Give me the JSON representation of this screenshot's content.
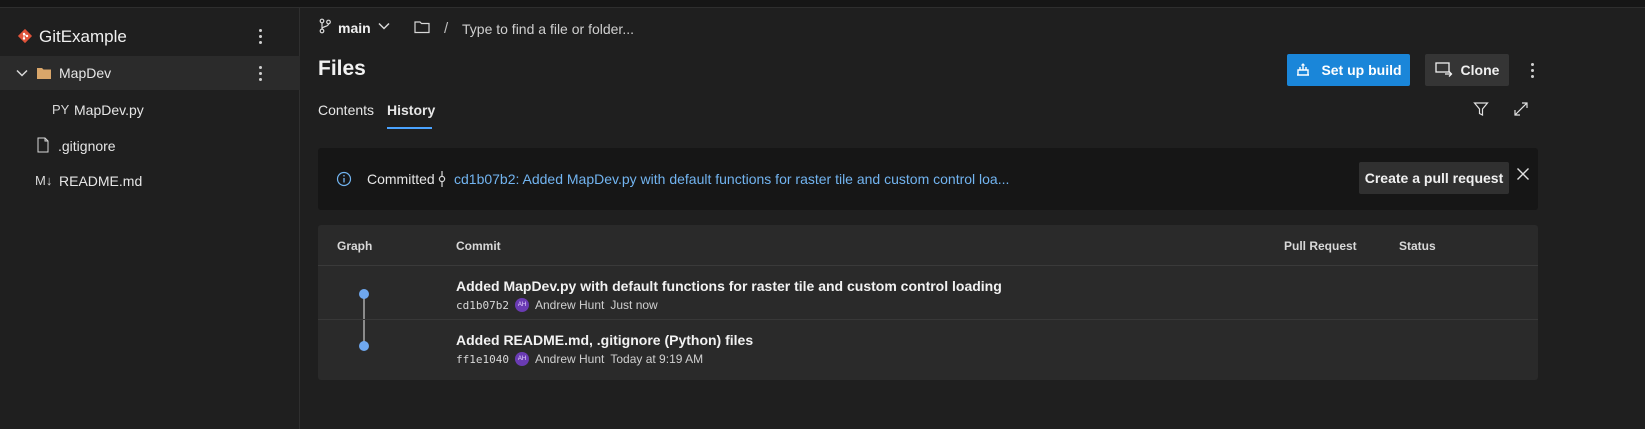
{
  "sidebar": {
    "repo_name": "GitExample",
    "items": [
      {
        "label": "MapDev",
        "type": "folder",
        "expanded": true
      },
      {
        "label": "MapDev.py",
        "type": "file",
        "prefix": "PY"
      },
      {
        "label": ".gitignore",
        "type": "file"
      },
      {
        "label": "README.md",
        "type": "file",
        "prefix": "M↓"
      }
    ]
  },
  "breadcrumb": {
    "branch": "main",
    "separator": "/",
    "path_placeholder": "Type to find a file or folder..."
  },
  "header": {
    "title": "Files",
    "setup_build_label": "Set up build",
    "clone_label": "Clone"
  },
  "tabs": [
    {
      "label": "Contents",
      "active": false
    },
    {
      "label": "History",
      "active": true
    }
  ],
  "banner": {
    "prefix": "Committed",
    "commit_text": "cd1b07b2: Added MapDev.py with default functions for raster tile and custom control loa...",
    "pull_request_label": "Create a pull request"
  },
  "history_table": {
    "columns": [
      "Graph",
      "Commit",
      "Pull Request",
      "Status"
    ],
    "rows": [
      {
        "message": "Added MapDev.py with default functions for raster tile and custom control loading",
        "hash": "cd1b07b2",
        "author_initials": "AH",
        "author": "Andrew Hunt",
        "time": "Just now"
      },
      {
        "message": "Added README.md, .gitignore (Python) files",
        "hash": "ff1e1040",
        "author_initials": "AH",
        "author": "Andrew Hunt",
        "time": "Today at 9:19 AM"
      }
    ]
  },
  "colors": {
    "accent": "#1a86d9",
    "link": "#72b4f0",
    "graph_node": "#6fa8ef",
    "avatar": "#6a3bb3",
    "repo_icon": "#e0533a",
    "folder": "#d9a66a"
  }
}
